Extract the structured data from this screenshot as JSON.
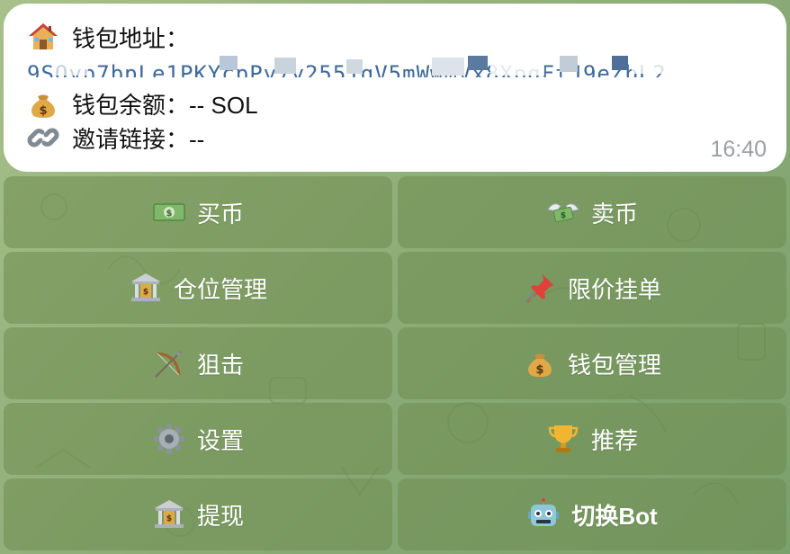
{
  "message": {
    "address_label": "钱包地址：",
    "address_value": "9SQyp7bpLe1PKYcpPy7y2551gV5mWwmVx8XpqFtJ9eZbL2",
    "balance_label": "钱包余额：-- SOL",
    "invite_label": "邀请链接：--",
    "time": "16:40",
    "icons": {
      "address": "house-icon",
      "balance": "money-bag-icon",
      "invite": "link-icon"
    }
  },
  "keyboard": {
    "buttons": [
      {
        "label": "买币",
        "icon": "dollar-banknote-icon"
      },
      {
        "label": "卖币",
        "icon": "money-with-wings-icon"
      },
      {
        "label": "仓位管理",
        "icon": "bank-icon"
      },
      {
        "label": "限价挂单",
        "icon": "pushpin-icon"
      },
      {
        "label": "狙击",
        "icon": "bow-and-arrow-icon"
      },
      {
        "label": "钱包管理",
        "icon": "money-bag-icon"
      },
      {
        "label": "设置",
        "icon": "gear-icon"
      },
      {
        "label": "推荐",
        "icon": "trophy-icon"
      },
      {
        "label": "提现",
        "icon": "bank-icon"
      },
      {
        "label": "切换Bot",
        "icon": "robot-icon"
      }
    ]
  },
  "colors": {
    "background": "#8fae78",
    "button_fill": "#7c9a62",
    "address_text": "#3d6a9c",
    "time_text": "#9aa0a6"
  }
}
